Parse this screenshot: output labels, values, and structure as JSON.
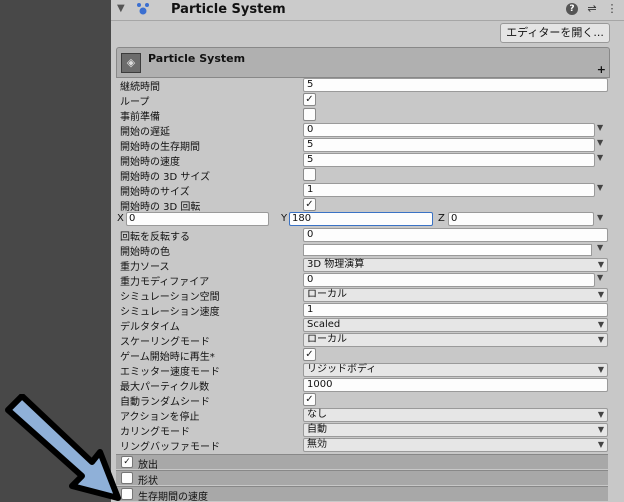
{
  "header": {
    "title": "Particle System",
    "open_editor": "エディターを開く...",
    "help_icon": "?",
    "settings_icon": "⇌",
    "menu_icon": "⋮"
  },
  "module": {
    "title": "Particle System",
    "plus": "+",
    "rows": [
      {
        "label": "継続時間",
        "type": "field",
        "value": "5"
      },
      {
        "label": "ループ",
        "type": "check",
        "checked": true
      },
      {
        "label": "事前準備",
        "type": "check",
        "checked": false
      },
      {
        "label": "開始の遅延",
        "type": "field_curve",
        "value": "0"
      },
      {
        "label": "開始時の生存期間",
        "type": "field_curve",
        "value": "5"
      },
      {
        "label": "開始時の速度",
        "type": "field_curve",
        "value": "5"
      },
      {
        "label": "開始時の 3D サイズ",
        "type": "check",
        "checked": false
      },
      {
        "label": "開始時のサイズ",
        "type": "field_curve",
        "value": "1"
      },
      {
        "label": "開始時の 3D 回転",
        "type": "check",
        "checked": true
      },
      {
        "label": "",
        "type": "xyz",
        "x": "0",
        "y": "180",
        "z": "0"
      },
      {
        "label": "回転を反転する",
        "type": "field",
        "value": "0"
      },
      {
        "label": "開始時の色",
        "type": "color"
      },
      {
        "label": "重力ソース",
        "type": "dropdown",
        "value": "3D 物理演算"
      },
      {
        "label": "重力モディファイア",
        "type": "field_curve",
        "value": "0"
      },
      {
        "label": "シミュレーション空間",
        "type": "dropdown",
        "value": "ローカル"
      },
      {
        "label": "シミュレーション速度",
        "type": "field",
        "value": "1"
      },
      {
        "label": "デルタタイム",
        "type": "dropdown",
        "value": "Scaled"
      },
      {
        "label": "スケーリングモード",
        "type": "dropdown",
        "value": "ローカル"
      },
      {
        "label": "ゲーム開始時に再生*",
        "type": "check",
        "checked": true
      },
      {
        "label": "エミッター速度モード",
        "type": "dropdown",
        "value": "リジッドボディ"
      },
      {
        "label": "最大パーティクル数",
        "type": "field",
        "value": "1000"
      },
      {
        "label": "自動ランダムシード",
        "type": "check",
        "checked": true
      },
      {
        "label": "アクションを停止",
        "type": "dropdown",
        "value": "なし"
      },
      {
        "label": "カリングモード",
        "type": "dropdown",
        "value": "自動"
      },
      {
        "label": "リングバッファモード",
        "type": "dropdown",
        "value": "無効"
      }
    ]
  },
  "xyz_labels": {
    "x": "X",
    "y": "Y",
    "z": "Z"
  },
  "sub_modules": [
    {
      "label": "放出",
      "checked": true
    },
    {
      "label": "形状",
      "checked": false
    },
    {
      "label": "生存期間の速度",
      "checked": false
    }
  ],
  "colors": {
    "arrow_fill": "#8fb0d8",
    "arrow_stroke": "#000000",
    "panel": "#c8c8c8"
  }
}
